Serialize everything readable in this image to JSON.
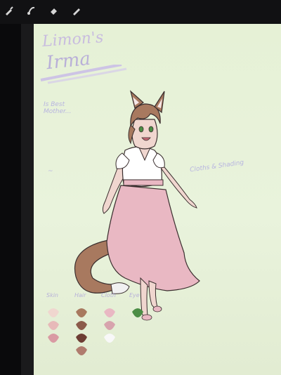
{
  "canvas": {
    "title_line1": "Limon's",
    "title_line2": "Irma",
    "note_left": "Is Best Mother...",
    "note_right": "Cloths & Shading",
    "note_small": "~",
    "palette_labels": [
      "Skin",
      "Hair",
      "Cloth",
      "Eye"
    ]
  },
  "colors": {
    "background": "#e6f1d6",
    "skin": "#f0d6cf",
    "hair": "#a8795f",
    "skirt": "#e9b8c3",
    "eye": "#4c8d45",
    "ink": "#3a2e2e"
  },
  "icons": [
    "brush-icon",
    "smudge-icon",
    "eraser-icon",
    "pen-icon"
  ]
}
